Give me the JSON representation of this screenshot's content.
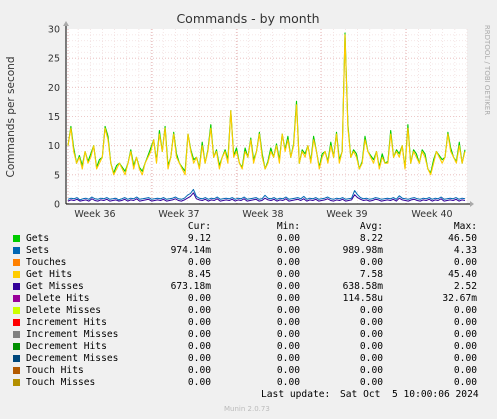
{
  "chart_data": {
    "type": "line",
    "title": "Commands - by month",
    "ylabel": "Commands per second",
    "side_label": "RRDTOOL / TOBI OETIKER",
    "ylim": [
      0,
      30
    ],
    "y_ticks": [
      0,
      5,
      10,
      15,
      20,
      25,
      30
    ],
    "x_ticks": [
      "Week 36",
      "Week 37",
      "Week 38",
      "Week 39",
      "Week 40"
    ],
    "grid": true,
    "legend_position": "bottom",
    "columns": [
      "Cur:",
      "Min:",
      "Avg:",
      "Max:"
    ],
    "series": [
      {
        "name": "Gets",
        "color": "#00cc00",
        "cur": "9.12",
        "min": "0.00",
        "avg": "8.22",
        "max": "46.50"
      },
      {
        "name": "Sets",
        "color": "#0066b3",
        "cur": "974.14m",
        "min": "0.00",
        "avg": "989.98m",
        "max": "4.33"
      },
      {
        "name": "Touches",
        "color": "#ff8000",
        "cur": "0.00",
        "min": "0.00",
        "avg": "0.00",
        "max": "0.00"
      },
      {
        "name": "Get Hits",
        "color": "#ffcc00",
        "cur": "8.45",
        "min": "0.00",
        "avg": "7.58",
        "max": "45.40"
      },
      {
        "name": "Get Misses",
        "color": "#330099",
        "cur": "673.18m",
        "min": "0.00",
        "avg": "638.58m",
        "max": "2.52"
      },
      {
        "name": "Delete Hits",
        "color": "#990099",
        "cur": "0.00",
        "min": "0.00",
        "avg": "114.58u",
        "max": "32.67m"
      },
      {
        "name": "Delete Misses",
        "color": "#ccff00",
        "cur": "0.00",
        "min": "0.00",
        "avg": "0.00",
        "max": "0.00"
      },
      {
        "name": "Increment Hits",
        "color": "#ff0000",
        "cur": "0.00",
        "min": "0.00",
        "avg": "0.00",
        "max": "0.00"
      },
      {
        "name": "Increment Misses",
        "color": "#808080",
        "cur": "0.00",
        "min": "0.00",
        "avg": "0.00",
        "max": "0.00"
      },
      {
        "name": "Decrement Hits",
        "color": "#008f00",
        "cur": "0.00",
        "min": "0.00",
        "avg": "0.00",
        "max": "0.00"
      },
      {
        "name": "Decrement Misses",
        "color": "#00487d",
        "cur": "0.00",
        "min": "0.00",
        "avg": "0.00",
        "max": "0.00"
      },
      {
        "name": "Touch Hits",
        "color": "#b35a00",
        "cur": "0.00",
        "min": "0.00",
        "avg": "0.00",
        "max": "0.00"
      },
      {
        "name": "Touch Misses",
        "color": "#b38f00",
        "cur": "0.00",
        "min": "0.00",
        "avg": "0.00",
        "max": "0.00"
      }
    ],
    "line_data": {
      "get_hits": [
        10,
        13,
        9,
        7,
        8,
        6,
        9,
        7,
        8,
        10,
        6,
        7,
        8,
        13,
        11,
        7,
        5,
        6,
        7,
        6,
        5,
        7,
        9,
        6,
        8,
        6,
        5,
        7,
        8,
        9,
        11,
        7,
        12,
        9,
        13,
        6,
        8,
        12,
        8,
        7,
        6,
        5,
        12,
        9,
        7,
        8,
        6,
        10,
        7,
        9,
        13,
        8,
        9,
        6,
        8,
        9,
        7,
        16,
        8,
        9,
        7,
        6,
        9,
        8,
        11,
        7,
        9,
        12,
        8,
        6,
        7,
        9,
        8,
        10,
        7,
        12,
        9,
        11,
        8,
        10,
        17,
        7,
        9,
        8,
        10,
        7,
        11,
        9,
        6,
        8,
        9,
        7,
        10,
        8,
        12,
        7,
        9,
        29,
        13,
        8,
        9,
        8,
        6,
        7,
        11,
        9,
        8,
        7,
        9,
        6,
        8,
        7,
        7,
        12,
        8,
        9,
        8,
        10,
        6,
        13,
        7,
        9,
        8,
        7,
        9,
        8,
        6,
        5,
        7,
        9,
        8,
        7,
        8,
        12,
        9,
        8,
        7,
        10,
        7,
        9
      ],
      "sets": [
        0.8,
        1.0,
        0.9,
        1.1,
        0.7,
        0.9,
        1.0,
        0.8,
        1.2,
        0.9,
        0.8,
        1.0,
        0.9,
        1.1,
        0.8,
        0.9,
        1.0,
        0.7,
        0.9,
        1.1,
        0.8,
        1.0,
        0.9,
        1.2,
        0.8,
        0.9,
        1.0,
        1.1,
        0.8,
        0.9,
        1.0,
        0.9,
        1.1,
        0.8,
        0.9,
        1.0,
        1.2,
        0.9,
        0.8,
        1.0,
        1.5,
        1.8,
        2.5,
        1.3,
        1.0,
        0.9,
        1.1,
        0.8,
        1.0,
        0.9,
        1.2,
        0.8,
        0.9,
        1.0,
        0.9,
        1.1,
        0.8,
        1.0,
        0.9,
        1.2,
        0.8,
        0.9,
        1.0,
        1.1,
        0.8,
        0.9,
        1.5,
        1.0,
        0.9,
        1.1,
        0.8,
        1.0,
        0.9,
        1.2,
        0.8,
        0.9,
        1.0,
        1.1,
        0.9,
        1.3,
        0.8,
        1.0,
        0.9,
        1.1,
        0.8,
        0.9,
        1.0,
        1.2,
        0.9,
        0.8,
        1.0,
        0.9,
        1.1,
        0.8,
        0.9,
        1.0,
        2.3,
        1.6,
        1.1,
        0.9,
        1.0,
        0.8,
        0.9,
        1.1,
        1.0,
        0.8,
        0.9,
        1.0,
        0.9,
        1.1,
        0.8,
        1.4,
        1.0,
        0.9,
        0.8,
        1.0,
        1.1,
        0.9,
        0.8,
        1.0,
        0.9,
        1.1,
        0.8,
        1.0,
        0.9,
        1.2,
        0.8,
        0.9,
        1.0,
        0.9,
        1.1,
        0.8,
        1.0,
        0.9
      ],
      "get_misses": [
        0.5,
        0.7,
        0.6,
        0.8,
        0.5,
        0.6,
        0.7,
        0.5,
        0.9,
        0.6,
        0.5,
        0.7,
        0.6,
        0.8,
        0.5,
        0.6,
        0.7,
        0.5,
        0.6,
        0.8,
        0.5,
        0.7,
        0.6,
        0.9,
        0.5,
        0.6,
        0.7,
        0.8,
        0.5,
        0.6,
        0.7,
        0.6,
        0.8,
        0.5,
        0.6,
        0.7,
        0.9,
        0.6,
        0.5,
        0.7,
        1.0,
        1.3,
        1.9,
        0.9,
        0.7,
        0.6,
        0.8,
        0.5,
        0.7,
        0.6,
        0.9,
        0.5,
        0.6,
        0.7,
        0.6,
        0.8,
        0.5,
        0.7,
        0.6,
        0.9,
        0.5,
        0.6,
        0.7,
        0.8,
        0.5,
        0.6,
        1.0,
        0.7,
        0.6,
        0.8,
        0.5,
        0.7,
        0.6,
        0.9,
        0.5,
        0.6,
        0.7,
        0.8,
        0.6,
        0.9,
        0.5,
        0.7,
        0.6,
        0.8,
        0.5,
        0.6,
        0.7,
        0.9,
        0.6,
        0.5,
        0.7,
        0.6,
        0.8,
        0.5,
        0.6,
        0.7,
        1.6,
        1.1,
        0.8,
        0.6,
        0.7,
        0.5,
        0.6,
        0.8,
        0.7,
        0.5,
        0.6,
        0.7,
        0.6,
        0.8,
        0.5,
        1.0,
        0.7,
        0.6,
        0.5,
        0.7,
        0.8,
        0.6,
        0.5,
        0.7,
        0.6,
        0.8,
        0.5,
        0.7,
        0.6,
        0.9,
        0.5,
        0.6,
        0.7,
        0.6,
        0.8,
        0.5,
        0.7,
        0.6
      ]
    },
    "last_update_label": "Last update:",
    "last_update": "Sat Oct  5 10:00:06 2024",
    "footer": "Munin 2.0.73"
  }
}
